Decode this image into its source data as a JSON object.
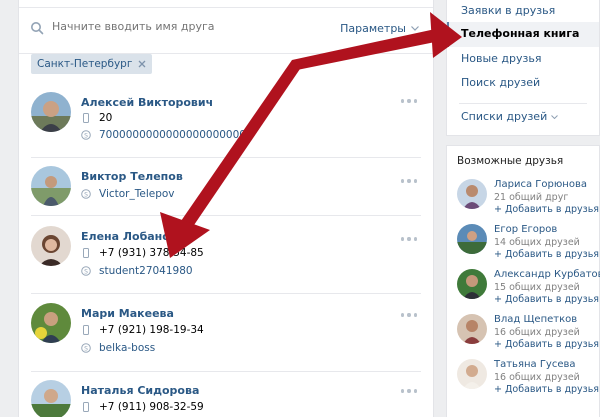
{
  "search": {
    "placeholder": "Начните вводить имя друга",
    "params_label": "Параметры"
  },
  "filter_chip": "Санкт-Петербург",
  "friends": [
    {
      "name": "Алексей Викторович",
      "line1": "20",
      "line2": "70000000000000000000000"
    },
    {
      "name": "Виктор Телепов",
      "line1": "Victor_Telepov"
    },
    {
      "name": "Елена Лобанова",
      "line1": "+7 (931) 378-54-85",
      "line2": "student27041980"
    },
    {
      "name": "Мари Макеева",
      "line1": "+7 (921) 198-19-34",
      "line2": "belka-boss"
    },
    {
      "name": "Наталья Сидорова",
      "line1": "+7 (911) 908-32-59"
    }
  ],
  "right_nav": {
    "requests": "Заявки в друзья",
    "phonebook": "Телефонная книга",
    "new_friends": "Новые друзья",
    "search_friends": "Поиск друзей",
    "friend_lists": "Списки друзей"
  },
  "possible": {
    "title": "Возможные друзья",
    "items": [
      {
        "name": "Лариса Горюнова",
        "common": "21 общий друг",
        "add": "+ Добавить в друзья"
      },
      {
        "name": "Егор Егоров",
        "common": "14 общих друзей",
        "add": "+ Добавить в друзья"
      },
      {
        "name": "Александр Курбатов",
        "common": "15 общих друзей",
        "add": "+ Добавить в друзья"
      },
      {
        "name": "Влад Щепетков",
        "common": "16 общих друзей",
        "add": "+ Добавить в друзья"
      },
      {
        "name": "Татьяна Гусева",
        "common": "16 общих друзей",
        "add": "+ Добавить в друзья"
      }
    ]
  },
  "colors": {
    "link": "#2a5885",
    "arrow": "#b0121e",
    "bg": "#edeef0"
  }
}
